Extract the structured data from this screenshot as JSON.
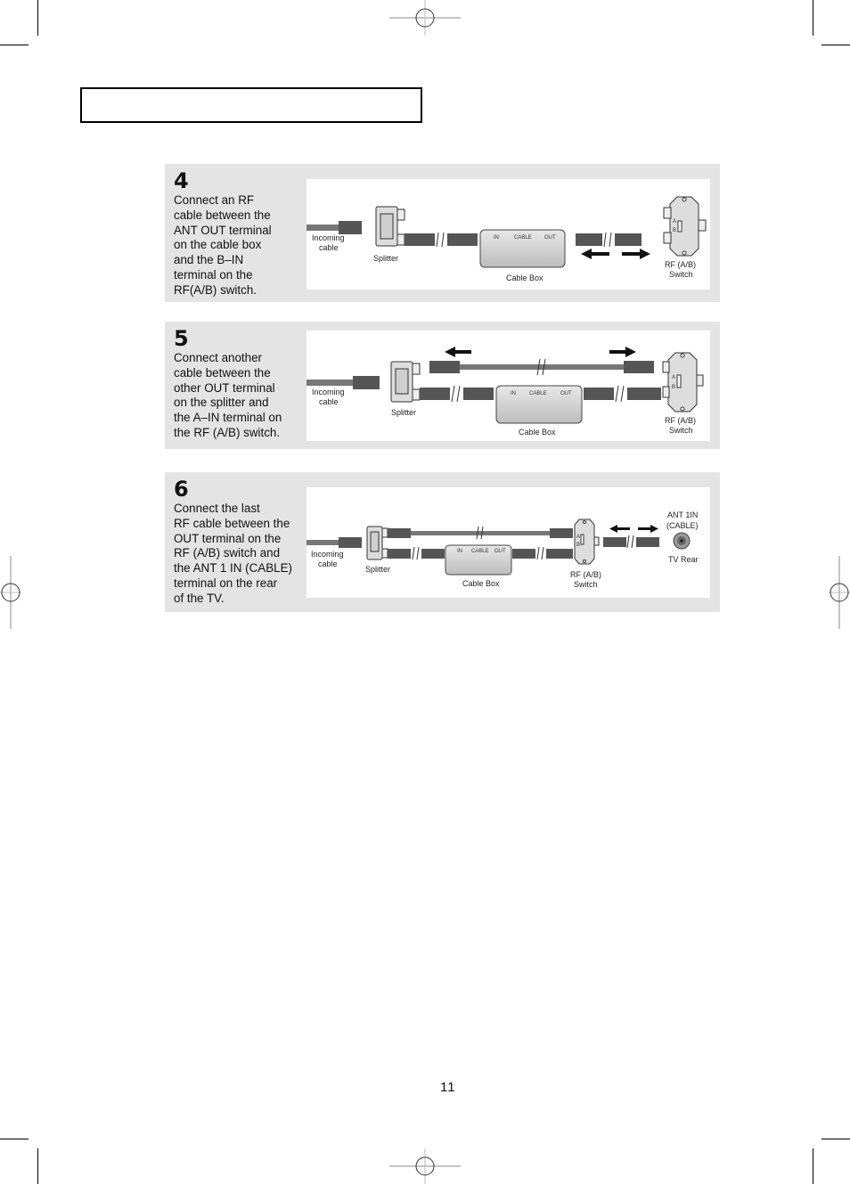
{
  "header": {
    "title": ""
  },
  "steps": [
    {
      "number": "4",
      "text": "Connect an RF\ncable between the\nANT OUT terminal\non the cable box\nand the B–IN\nterminal on the\nRF(A/B) switch.",
      "diagram": {
        "incoming_cable": "Incoming\ncable",
        "incoming_cable_l1": "Incoming",
        "incoming_cable_l2": "cable",
        "splitter": "Splitter",
        "cable_box": "Cable Box",
        "cable_box_ports": {
          "in": "IN",
          "cable": "CABLE",
          "out": "OUT"
        },
        "rf_switch_l1": "RF (A/B)",
        "rf_switch_l2": "Switch",
        "switch_a": "A",
        "switch_b": "B"
      }
    },
    {
      "number": "5",
      "text": "Connect another\ncable between the\nother OUT terminal\non the splitter and\nthe A–IN terminal on\nthe RF (A/B) switch.",
      "diagram": {
        "incoming_cable_l1": "Incoming",
        "incoming_cable_l2": "cable",
        "splitter": "Splitter",
        "cable_box": "Cable Box",
        "cable_box_ports": {
          "in": "IN",
          "cable": "CABLE",
          "out": "OUT"
        },
        "rf_switch_l1": "RF (A/B)",
        "rf_switch_l2": "Switch",
        "switch_a": "A",
        "switch_b": "B"
      }
    },
    {
      "number": "6",
      "text": "Connect the last\nRF cable between the\nOUT terminal on the\nRF (A/B) switch and\nthe ANT 1 IN (CABLE)\nterminal on the rear\nof the TV.",
      "diagram": {
        "incoming_cable_l1": "Incoming",
        "incoming_cable_l2": "cable",
        "splitter": "Splitter",
        "cable_box": "Cable Box",
        "cable_box_ports": {
          "in": "IN",
          "cable": "CABLE",
          "out": "OUT"
        },
        "rf_switch_l1": "RF (A/B)",
        "rf_switch_l2": "Switch",
        "switch_a": "A",
        "switch_b": "B",
        "ant_label_l1": "ANT 1IN",
        "ant_label_l2": "(CABLE)",
        "tv_rear": "TV Rear"
      }
    }
  ],
  "footer": {
    "page_number": "11"
  }
}
